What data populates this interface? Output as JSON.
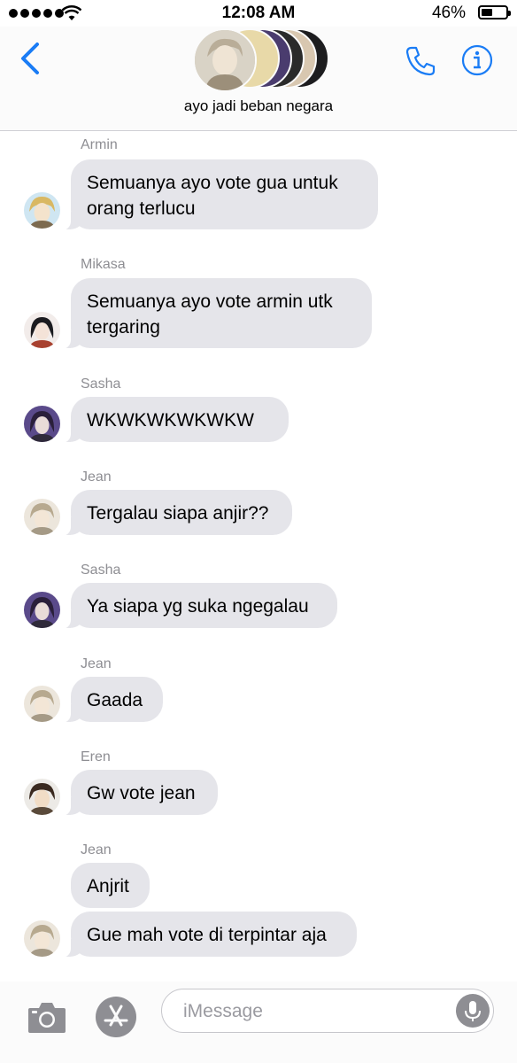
{
  "status_bar": {
    "time": "12:08 AM",
    "battery_percent": "46%",
    "battery_level": 0.46,
    "signal_bars": 5
  },
  "header": {
    "group_name": "ayo jadi beban negara",
    "back_icon": "chevron-left-icon",
    "call_icon": "phone-icon",
    "info_icon": "info-icon",
    "avatars": [
      "#c9c2b4",
      "#e8d9a8",
      "#4a3c6e",
      "#2a2a2a",
      "#d8c7b0",
      "#1d1d1f"
    ]
  },
  "messages": [
    {
      "sender": "Armin",
      "text": "Semuanya ayo vote gua untuk\norang terlucu"
    },
    {
      "sender": "Mikasa",
      "text": "Semuanya ayo vote armin utk\ntergaring"
    },
    {
      "sender": "Sasha",
      "text": "WKWKWKWKWKW"
    },
    {
      "sender": "Jean",
      "text": "Tergalau siapa anjir??"
    },
    {
      "sender": "Sasha",
      "text": "Ya siapa yg suka ngegalau"
    },
    {
      "sender": "Jean",
      "text": "Gaada"
    },
    {
      "sender": "Eren",
      "text": "Gw vote jean"
    },
    {
      "sender": "Jean",
      "text": "Anjrit"
    },
    {
      "sender": "",
      "text": "Gue mah vote di terpintar aja"
    }
  ],
  "input_bar": {
    "placeholder": "iMessage",
    "camera_icon": "camera-icon",
    "apps_icon": "app-store-icon",
    "mic_icon": "microphone-icon"
  },
  "colors": {
    "accent": "#1a7cf5",
    "bubble": "#e5e5ea",
    "sender_label": "#8e8e93"
  }
}
